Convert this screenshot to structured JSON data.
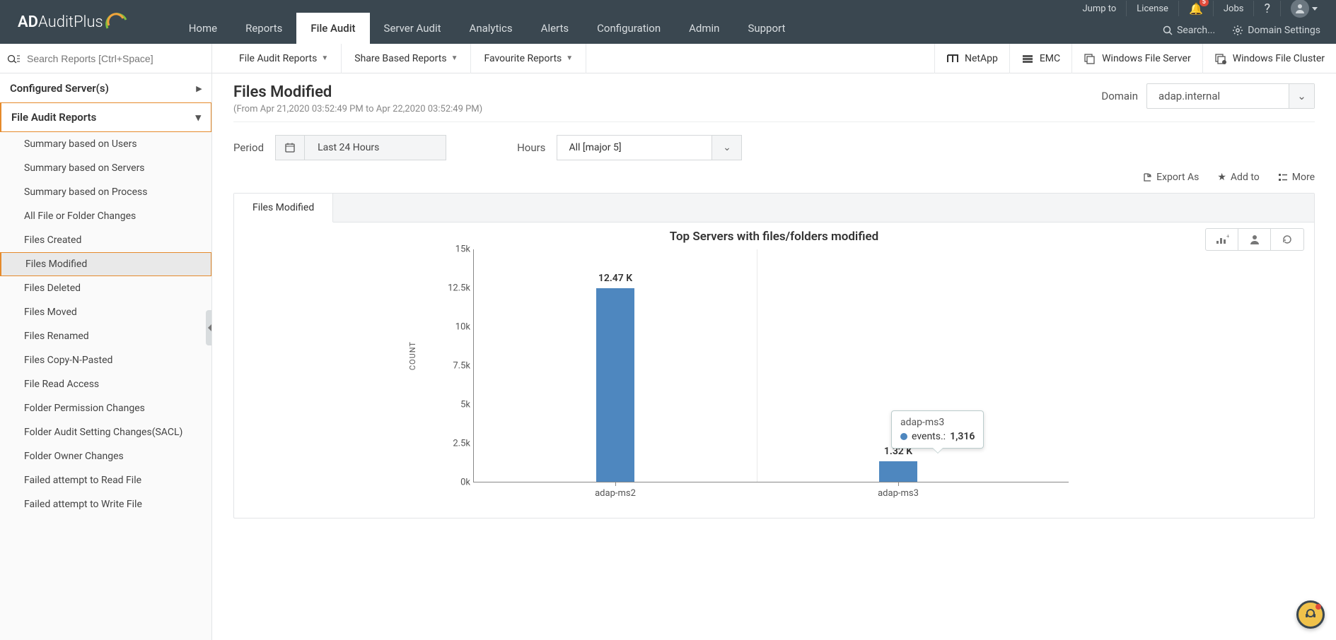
{
  "brand": {
    "prefix": "AD",
    "mid": "Audit",
    "suffix": " Plus"
  },
  "top_links": {
    "jump_to": "Jump to",
    "license": "License",
    "notif_count": "5",
    "jobs": "Jobs"
  },
  "top_tools": {
    "search_placeholder": "Search...",
    "domain_settings": "Domain Settings"
  },
  "main_tabs": [
    "Home",
    "Reports",
    "File Audit",
    "Server Audit",
    "Analytics",
    "Alerts",
    "Configuration",
    "Admin",
    "Support"
  ],
  "main_tab_active": "File Audit",
  "sec_search_placeholder": "Search Reports [Ctrl+Space]",
  "sec_tabs": [
    "File Audit Reports",
    "Share Based Reports",
    "Favourite Reports"
  ],
  "sec_right": [
    "NetApp",
    "EMC",
    "Windows File Server",
    "Windows File Cluster"
  ],
  "sidebar": {
    "servers_header": "Configured Server(s)",
    "section": "File Audit Reports",
    "items": [
      "Summary based on Users",
      "Summary based on Servers",
      "Summary based on Process",
      "All File or Folder Changes",
      "Files Created",
      "Files Modified",
      "Files Deleted",
      "Files Moved",
      "Files Renamed",
      "Files Copy-N-Pasted",
      "File Read Access",
      "Folder Permission Changes",
      "Folder Audit Setting Changes(SACL)",
      "Folder Owner Changes",
      "Failed attempt to Read File",
      "Failed attempt to Write File"
    ],
    "selected": "Files Modified"
  },
  "page": {
    "title": "Files Modified",
    "daterange": "(From Apr 21,2020 03:52:49 PM to Apr 22,2020 03:52:49 PM)",
    "domain_label": "Domain",
    "domain_value": "adap.internal",
    "period_label": "Period",
    "period_value": "Last 24 Hours",
    "hours_label": "Hours",
    "hours_value": "All [major 5]",
    "export_as": "Export As",
    "add_to": "Add to",
    "more": "More",
    "chart_tab": "Files Modified"
  },
  "chart_data": {
    "type": "bar",
    "title": "Top Servers with files/folders modified",
    "ylabel": "COUNT",
    "xlabel": "",
    "ylim": [
      0,
      15000
    ],
    "yticks": [
      0,
      2500,
      5000,
      7500,
      10000,
      12500,
      15000
    ],
    "ytick_labels": [
      "0k",
      "2.5k",
      "5k",
      "7.5k",
      "10k",
      "12.5k",
      "15k"
    ],
    "categories": [
      "adap-ms2",
      "adap-ms3"
    ],
    "values": [
      12470,
      1316
    ],
    "value_labels": [
      "12.47 K",
      "1.32 K"
    ],
    "tooltip": {
      "server": "adap-ms3",
      "metric_label": "events.:",
      "value": "1,316",
      "category_index": 1
    }
  }
}
